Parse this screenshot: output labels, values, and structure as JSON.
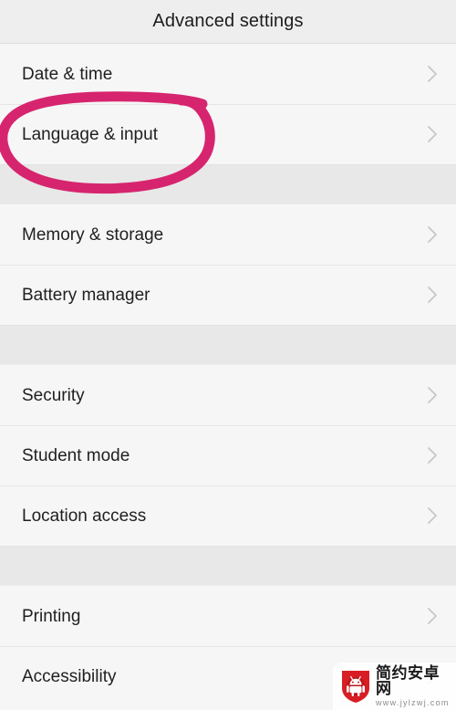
{
  "header": {
    "title": "Advanced settings"
  },
  "colors": {
    "annotation": "#d6256e",
    "row_background": "#f6f6f6",
    "gap_background": "#e8e8e8",
    "header_background": "#eeeeee",
    "text": "#1f1f1f",
    "chevron": "#c6c6c6",
    "watermark_red": "#d81e24"
  },
  "sections": [
    {
      "rows": [
        {
          "label": "Date & time",
          "chevron": "chevron-right-icon"
        },
        {
          "label": "Language & input",
          "chevron": "chevron-right-icon",
          "annotated": true
        }
      ]
    },
    {
      "rows": [
        {
          "label": "Memory & storage",
          "chevron": "chevron-right-icon"
        },
        {
          "label": "Battery manager",
          "chevron": "chevron-right-icon"
        }
      ]
    },
    {
      "rows": [
        {
          "label": "Security",
          "chevron": "chevron-right-icon"
        },
        {
          "label": "Student mode",
          "chevron": "chevron-right-icon"
        },
        {
          "label": "Location access",
          "chevron": "chevron-right-icon"
        }
      ]
    },
    {
      "rows": [
        {
          "label": "Printing",
          "chevron": "chevron-right-icon"
        },
        {
          "label": "Accessibility",
          "chevron": "chevron-right-icon"
        }
      ]
    }
  ],
  "annotation": {
    "shape": "hand-drawn-ellipse",
    "target": "Language & input"
  },
  "watermark": {
    "name": "简约安卓网",
    "url": "www.jylzwj.com",
    "logo": "android-shield-icon"
  }
}
